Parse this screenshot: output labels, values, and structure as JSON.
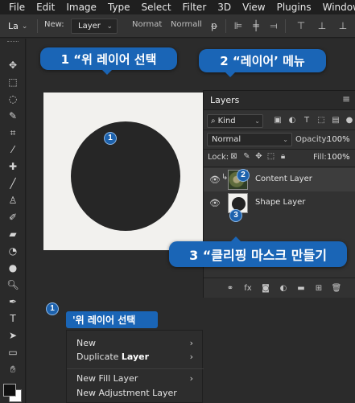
{
  "menubar": {
    "items": [
      "File",
      "Edit",
      "Image",
      "Type",
      "Select",
      "Filter",
      "3D",
      "View",
      "Plugins",
      "Window"
    ]
  },
  "options_bar": {
    "tool_preset": "La",
    "new_label": "New:",
    "new_value": "Layer",
    "mode_label": "Normat",
    "opacity_label": "Normall"
  },
  "tools": {
    "icons": [
      "move-icon",
      "marquee-icon",
      "lasso-icon",
      "quick-select-icon",
      "crop-icon",
      "eyedropper-icon",
      "healing-icon",
      "brush-icon",
      "clone-stamp-icon",
      "history-brush-icon",
      "eraser-icon",
      "gradient-icon",
      "blur-icon",
      "dodge-icon",
      "pen-icon",
      "type-icon",
      "path-select-icon",
      "rectangle-icon",
      "hand-icon",
      "zoom-icon"
    ]
  },
  "callouts": {
    "c1": "1 “위 레이어 선택",
    "c2": "2 “레이어’ 메뉴",
    "c3": "3 “클리핑 마스크 만들기"
  },
  "badges": {
    "b1": "1",
    "b2": "2",
    "b3": "3",
    "b4": "1"
  },
  "layers_panel": {
    "title": "Layers",
    "filter_kind": "Kind",
    "blend_mode": "Normal",
    "opacity_label": "Opacity:",
    "opacity_value": "100%",
    "lock_label": "Lock:",
    "fill_label": "Fill:",
    "fill_value": "100%",
    "layers": [
      {
        "name": "Content Layer",
        "visible": true,
        "selected": true,
        "clipped": true
      },
      {
        "name": "Shape Layer",
        "visible": true,
        "selected": false,
        "clipped": false
      }
    ]
  },
  "context_menu": {
    "header": "'위 레이어 선택",
    "items": [
      {
        "label": "New",
        "bold": "",
        "submenu": true
      },
      {
        "label": "Duplicate ",
        "bold": "Layer",
        "submenu": true
      },
      {
        "label": "New Fill Layer",
        "bold": "",
        "submenu": true
      },
      {
        "label": "New Adjustment Layer",
        "bold": "",
        "submenu": false
      }
    ]
  },
  "colors": {
    "accent_blue": "#1a65b6",
    "ui_dark": "#262626",
    "canvas_doc": "#f2f1ee"
  }
}
